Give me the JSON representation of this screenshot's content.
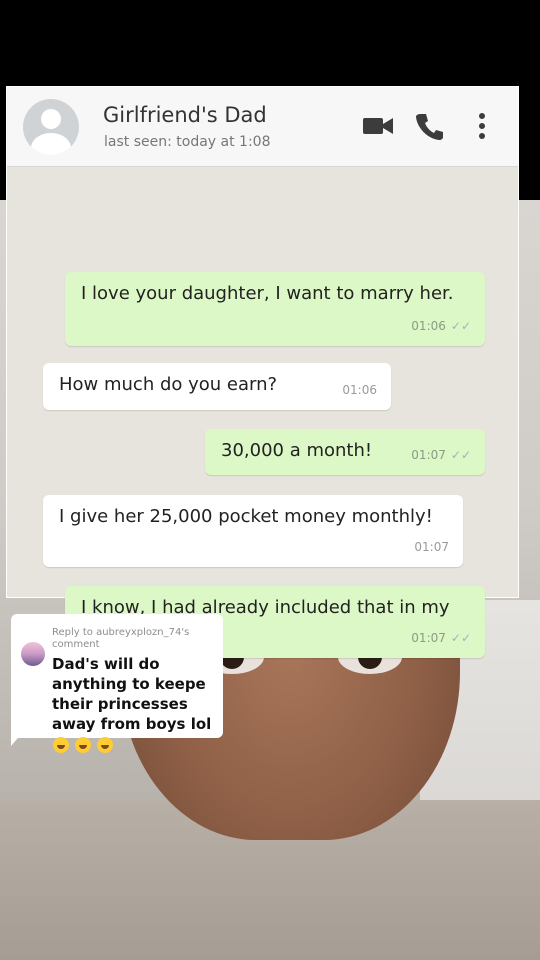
{
  "chat": {
    "contact_name": "Girlfriend's Dad",
    "last_seen": "last seen: today at 1:08",
    "icons": [
      "video-call-icon",
      "voice-call-icon",
      "more-options-icon"
    ],
    "messages": [
      {
        "direction": "out",
        "text": "I love your daughter, I want to marry her.",
        "time": "01:06",
        "ticks": "✓✓"
      },
      {
        "direction": "in",
        "text": "How much do you earn?",
        "time": "01:06"
      },
      {
        "direction": "out",
        "text": "30,000 a month!",
        "time": "01:07",
        "ticks": "✓✓"
      },
      {
        "direction": "in",
        "text": "I give her 25,000 pocket money monthly!",
        "time": "01:07"
      },
      {
        "direction": "out",
        "text": "I know, I had already included that in my salary!",
        "time": "01:07",
        "ticks": "✓✓"
      }
    ]
  },
  "reply": {
    "header": "Reply to aubreyxplozn_74's comment",
    "text": "Dad's will do anything to keepe their princesses away from boys lol",
    "emojis": [
      "grinning-sweat-emoji",
      "grinning-sweat-emoji",
      "smirk-emoji"
    ]
  },
  "colors": {
    "outgoing_bubble": "#dcf8c6",
    "incoming_bubble": "#ffffff",
    "chat_background": "#e7e3dd"
  }
}
